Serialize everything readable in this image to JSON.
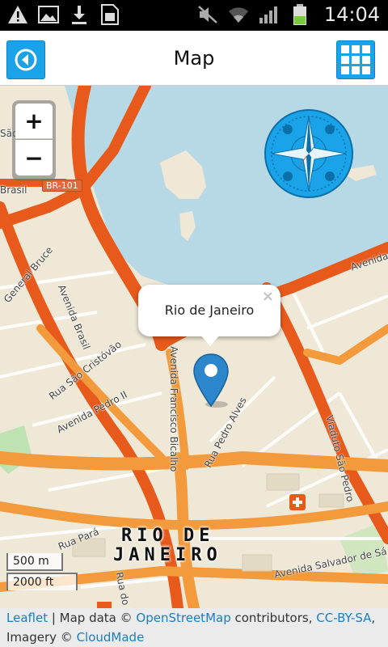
{
  "status_bar": {
    "time": "14:04",
    "left_icons": [
      "warning-icon",
      "image-icon",
      "download-icon",
      "sim-card-icon"
    ],
    "right_icons": [
      "mute-icon",
      "wifi-icon",
      "signal-icon",
      "battery-icon"
    ]
  },
  "header": {
    "title": "Map",
    "back_icon": "back-arrow-icon",
    "menu_icon": "grid-icon",
    "accent_color": "#1aa3e8"
  },
  "map": {
    "zoom_in_label": "+",
    "zoom_out_label": "−",
    "popup": {
      "text": "Rio de Janeiro",
      "close_label": "×"
    },
    "city_label_line1": "RIO DE",
    "city_label_line2": "JANEIRO",
    "scale": {
      "metric": "500 m",
      "imperial": "2000 ft"
    },
    "streets": [
      {
        "id": "avenida-brasil",
        "text": "Avenida Brasil"
      },
      {
        "id": "rua-sao-cristovao",
        "text": "Rua São Cristóvão"
      },
      {
        "id": "avenida-pedro-ii",
        "text": "Avenida Pedro II"
      },
      {
        "id": "avenida-francisco-bicalho",
        "text": "Avenida Francisco Bicalho"
      },
      {
        "id": "rua-pedro-alves",
        "text": "Rua Pedro Alves"
      },
      {
        "id": "viaduto-sao-pedro",
        "text": "Viaduto São Pedro"
      },
      {
        "id": "rua-para",
        "text": "Rua Pará"
      },
      {
        "id": "avenida-salvador-de-sa",
        "text": "Avenida Salvador de Sá"
      },
      {
        "id": "rua-do-matoso",
        "text": "Rua do Mat"
      },
      {
        "id": "general-bruce",
        "text": "General Bruce"
      },
      {
        "id": "avenida-right",
        "text": "Avenida"
      },
      {
        "id": "brasil-left",
        "text": "Brasil"
      },
      {
        "id": "sao-francisco",
        "text": "São Francisco Xavier"
      }
    ],
    "shield": "BR-101"
  },
  "attribution": {
    "leaflet": "Leaflet",
    "sep": " | Map data © ",
    "osm": "OpenStreetMap",
    "contributors": " contributors, ",
    "license": "CC-BY-SA",
    "comma": ",",
    "imagery_prefix": "Imagery © ",
    "cloudmade": "CloudMade"
  }
}
